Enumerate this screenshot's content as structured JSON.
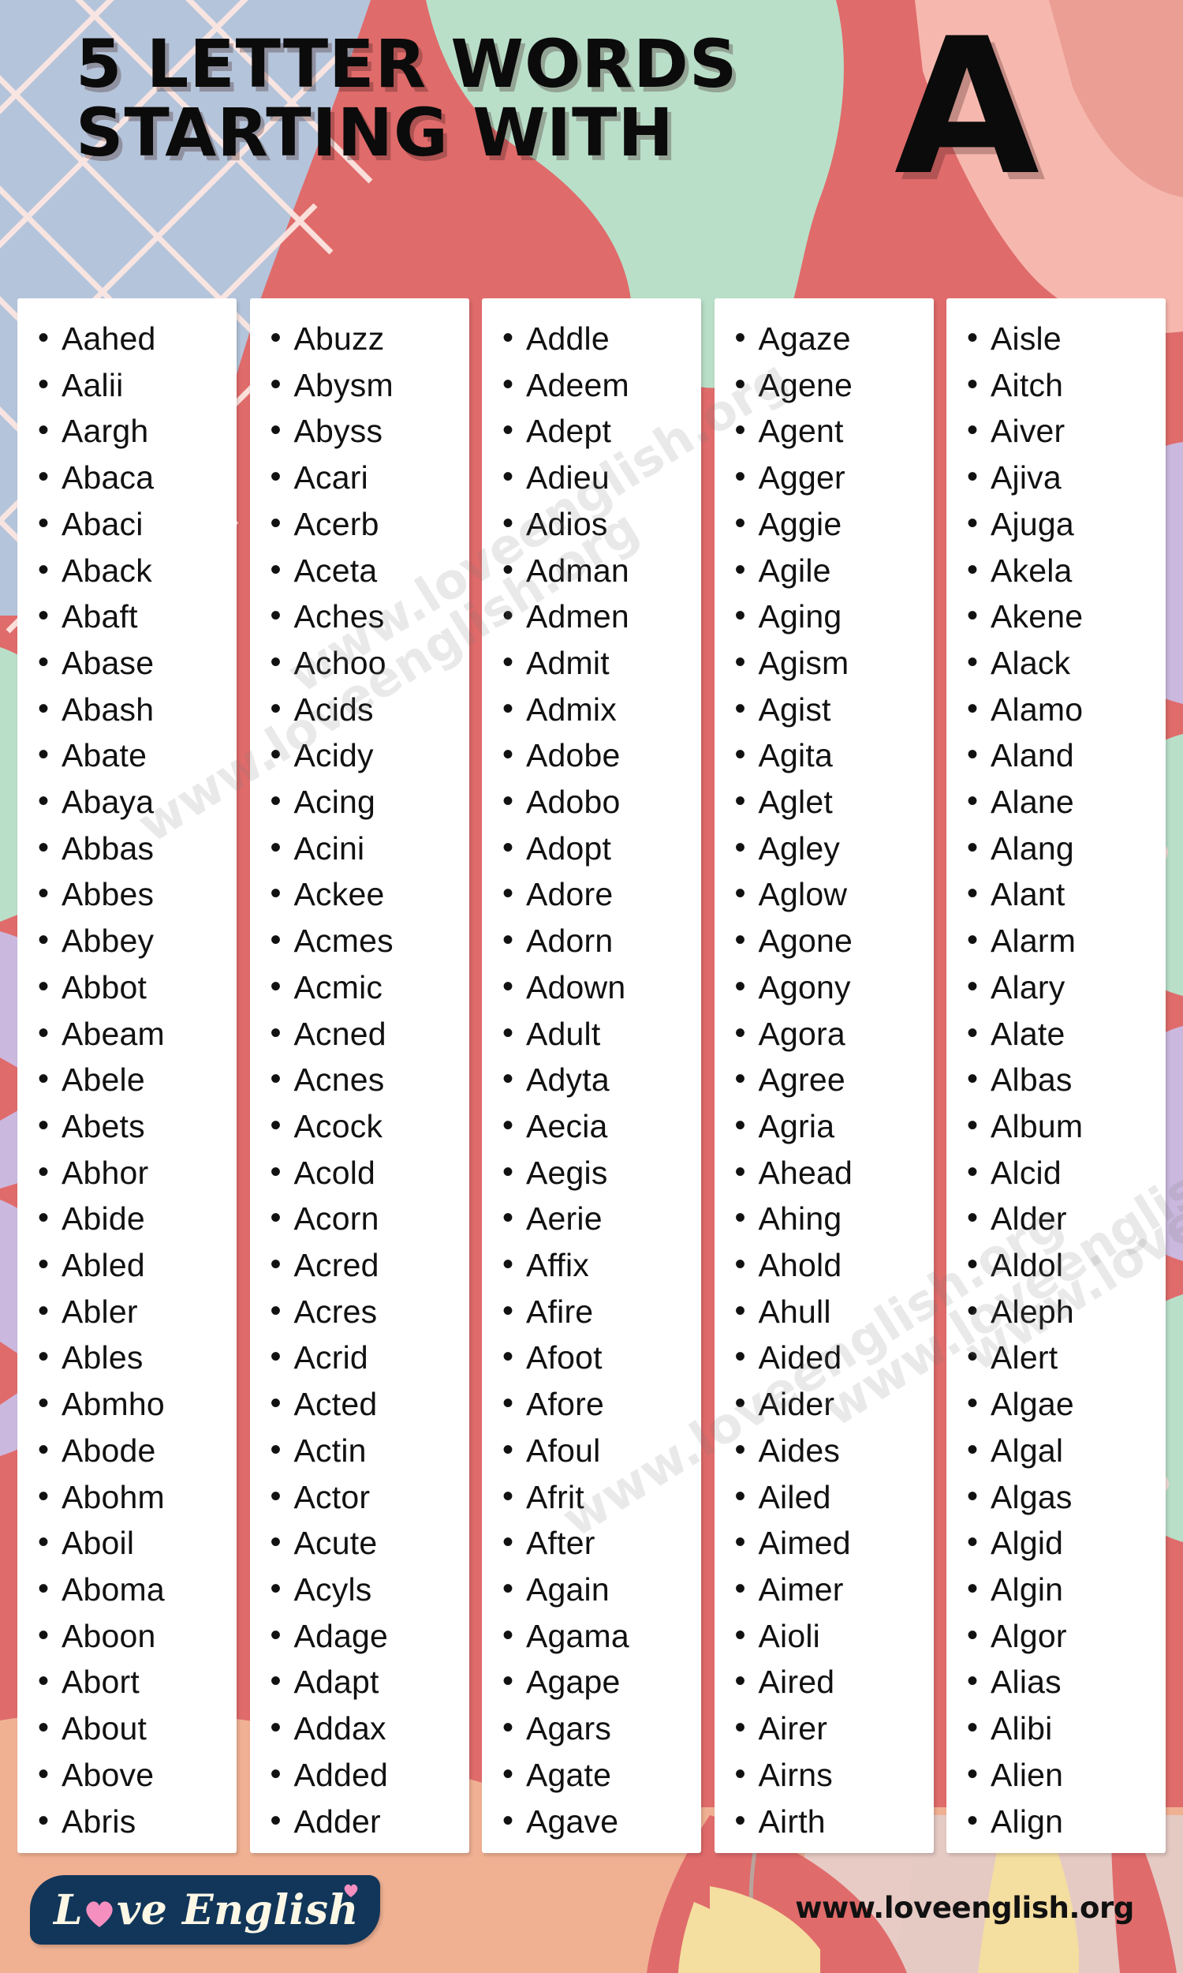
{
  "header": {
    "title_line1": "5 LETTER WORDS",
    "title_line2": "STARTING WITH",
    "big_letter": "A"
  },
  "colors": {
    "background_coral": "#e06b6b",
    "mint": "#b9dfc9",
    "blush": "#f6b8ae",
    "lavender": "#cbb8de",
    "periwinkle": "#b4c4da",
    "peach": "#f0b193",
    "butter": "#f4deA0",
    "card_white": "#ffffff",
    "logo_navy": "#11365a",
    "logo_pink": "#f58fc0",
    "text_black": "#111111"
  },
  "columns": [
    {
      "name": "column-1",
      "words": [
        "Aahed",
        "Aalii",
        "Aargh",
        "Abaca",
        "Abaci",
        "Aback",
        "Abaft",
        "Abase",
        "Abash",
        "Abate",
        "Abaya",
        "Abbas",
        "Abbes",
        "Abbey",
        "Abbot",
        "Abeam",
        "Abele",
        "Abets",
        "Abhor",
        "Abide",
        "Abled",
        "Abler",
        "Ables",
        "Abmho",
        "Abode",
        "Abohm",
        "Aboil",
        "Aboma",
        "Aboon",
        "Abort",
        "About",
        "Above",
        "Abris"
      ]
    },
    {
      "name": "column-2",
      "words": [
        "Abuzz",
        "Abysm",
        "Abyss",
        "Acari",
        "Acerb",
        "Aceta",
        "Aches",
        "Achoo",
        "Acids",
        "Acidy",
        "Acing",
        "Acini",
        "Ackee",
        "Acmes",
        "Acmic",
        "Acned",
        "Acnes",
        "Acock",
        "Acold",
        "Acorn",
        "Acred",
        "Acres",
        "Acrid",
        "Acted",
        "Actin",
        "Actor",
        "Acute",
        "Acyls",
        "Adage",
        "Adapt",
        "Addax",
        "Added",
        "Adder"
      ]
    },
    {
      "name": "column-3",
      "words": [
        "Addle",
        "Adeem",
        "Adept",
        "Adieu",
        "Adios",
        "Adman",
        "Admen",
        "Admit",
        "Admix",
        "Adobe",
        "Adobo",
        "Adopt",
        "Adore",
        "Adorn",
        "Adown",
        "Adult",
        "Adyta",
        "Aecia",
        "Aegis",
        "Aerie",
        "Affix",
        "Afire",
        "Afoot",
        "Afore",
        "Afoul",
        "Afrit",
        "After",
        "Again",
        "Agama",
        "Agape",
        "Agars",
        "Agate",
        "Agave"
      ]
    },
    {
      "name": "column-4",
      "words": [
        "Agaze",
        "Agene",
        "Agent",
        "Agger",
        "Aggie",
        "Agile",
        "Aging",
        "Agism",
        "Agist",
        "Agita",
        "Aglet",
        "Agley",
        "Aglow",
        "Agone",
        "Agony",
        "Agora",
        "Agree",
        "Agria",
        "Ahead",
        "Ahing",
        "Ahold",
        "Ahull",
        "Aided",
        "Aider",
        "Aides",
        "Ailed",
        "Aimed",
        "Aimer",
        "Aioli",
        "Aired",
        "Airer",
        "Airns",
        "Airth"
      ]
    },
    {
      "name": "column-5",
      "words": [
        "Aisle",
        "Aitch",
        "Aiver",
        "Ajiva",
        "Ajuga",
        "Akela",
        "Akene",
        "Alack",
        "Alamo",
        "Aland",
        "Alane",
        "Alang",
        "Alant",
        "Alarm",
        "Alary",
        "Alate",
        "Albas",
        "Album",
        "Alcid",
        "Alder",
        "Aldol",
        "Aleph",
        "Alert",
        "Algae",
        "Algal",
        "Algas",
        "Algid",
        "Algin",
        "Algor",
        "Alias",
        "Alibi",
        "Alien",
        "Align"
      ]
    }
  ],
  "watermarks": [
    "www.loveenglish.org",
    "www.loveenglish.org",
    "www.loveenglish.org",
    "www.loveenglish.org",
    "www.loveenglish.org"
  ],
  "footer": {
    "logo_first": "L",
    "logo_rest": "ve English",
    "site_url": "www.loveenglish.org"
  }
}
